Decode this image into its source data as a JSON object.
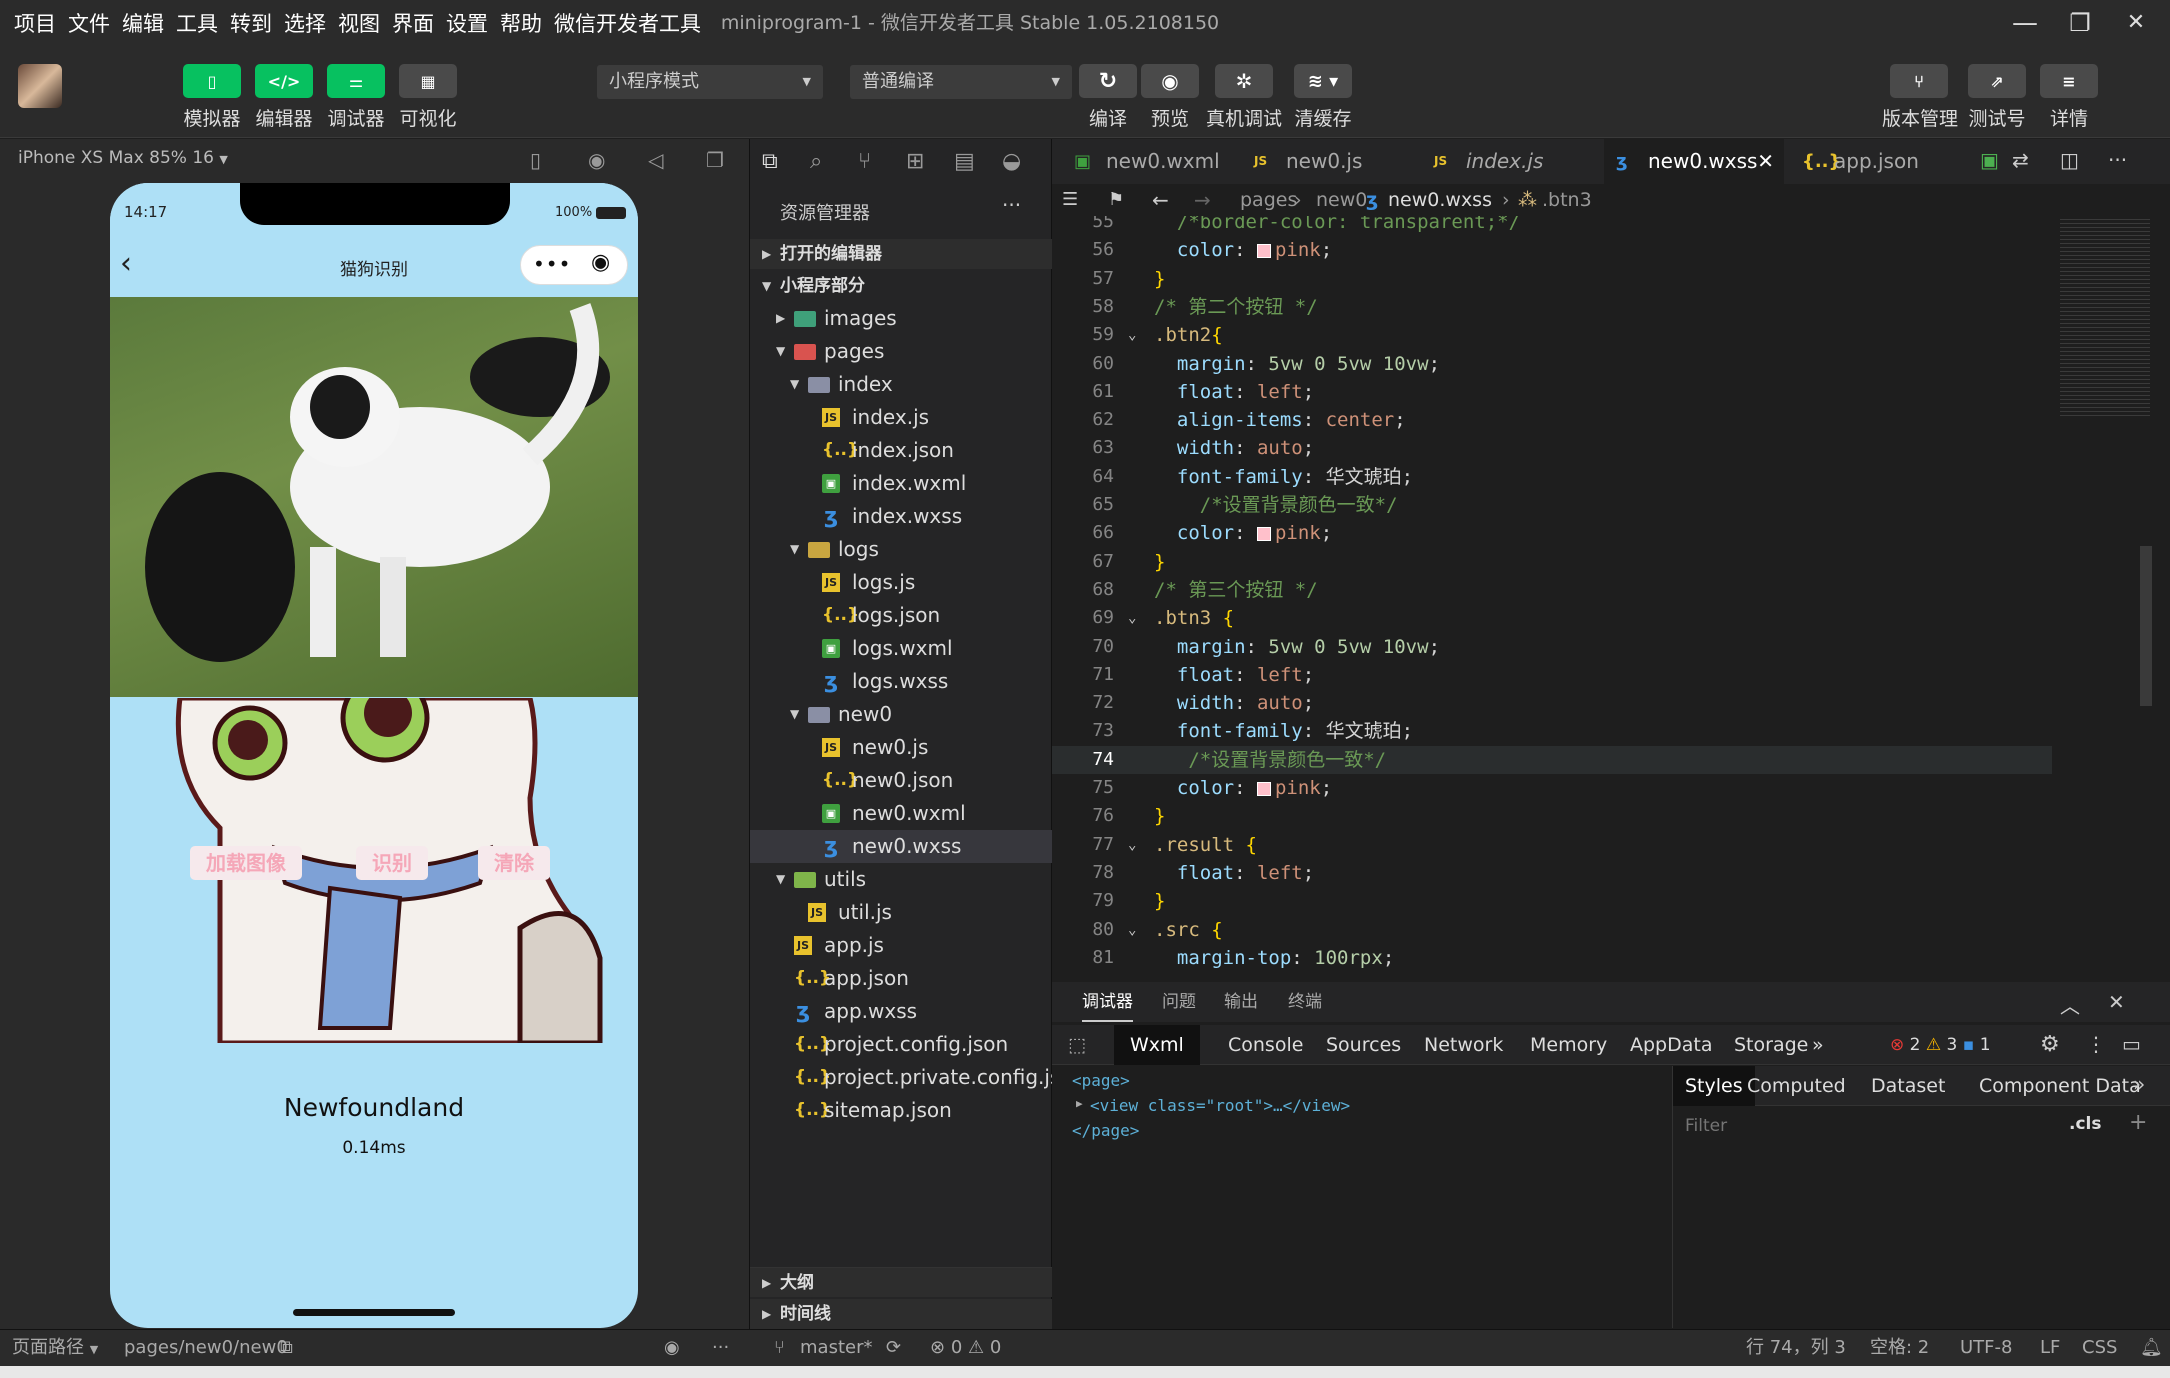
{
  "menu": [
    "项目",
    "文件",
    "编辑",
    "工具",
    "转到",
    "选择",
    "视图",
    "界面",
    "设置",
    "帮助",
    "微信开发者工具"
  ],
  "window_title": "miniprogram-1 - 微信开发者工具 Stable 1.05.2108150",
  "window_controls": {
    "minimize": "—",
    "maximize": "❐",
    "close": "✕"
  },
  "toolbar": {
    "simulator": "模拟器",
    "editor": "编辑器",
    "debugger": "调试器",
    "visual": "可视化",
    "mode": "小程序模式",
    "compile_mode": "普通编译",
    "compile": "编译",
    "preview": "预览",
    "real_debug": "真机调试",
    "clear_cache": "清缓存",
    "version": "版本管理",
    "test_id": "测试号",
    "details": "详情"
  },
  "simulator": {
    "device": "iPhone XS Max 85% 16",
    "time": "14:17",
    "battery": "100%",
    "nav_title": "猫狗识别",
    "buttons": [
      "加载图像",
      "识别",
      "清除"
    ],
    "result": "Newfoundland",
    "elapsed": "0.14ms"
  },
  "explorer": {
    "title": "资源管理器",
    "open_editors": "打开的编辑器",
    "project": "小程序部分",
    "tree": [
      {
        "label": "images",
        "depth": 1,
        "type": "folder-img",
        "twisty": "closed"
      },
      {
        "label": "pages",
        "depth": 1,
        "type": "folder-pg",
        "twisty": "open"
      },
      {
        "label": "index",
        "depth": 2,
        "type": "folder-idx",
        "twisty": "open"
      },
      {
        "label": "index.js",
        "depth": 3,
        "type": "js"
      },
      {
        "label": "index.json",
        "depth": 3,
        "type": "json"
      },
      {
        "label": "index.wxml",
        "depth": 3,
        "type": "wxml"
      },
      {
        "label": "index.wxss",
        "depth": 3,
        "type": "wxss"
      },
      {
        "label": "logs",
        "depth": 2,
        "type": "folder-lg",
        "twisty": "open"
      },
      {
        "label": "logs.js",
        "depth": 3,
        "type": "js"
      },
      {
        "label": "logs.json",
        "depth": 3,
        "type": "json"
      },
      {
        "label": "logs.wxml",
        "depth": 3,
        "type": "wxml"
      },
      {
        "label": "logs.wxss",
        "depth": 3,
        "type": "wxss"
      },
      {
        "label": "new0",
        "depth": 2,
        "type": "folder-idx",
        "twisty": "open"
      },
      {
        "label": "new0.js",
        "depth": 3,
        "type": "js"
      },
      {
        "label": "new0.json",
        "depth": 3,
        "type": "json"
      },
      {
        "label": "new0.wxml",
        "depth": 3,
        "type": "wxml"
      },
      {
        "label": "new0.wxss",
        "depth": 3,
        "type": "wxss",
        "selected": true
      },
      {
        "label": "utils",
        "depth": 1,
        "type": "folder-ut",
        "twisty": "open"
      },
      {
        "label": "util.js",
        "depth": 2,
        "type": "js"
      },
      {
        "label": "app.js",
        "depth": 1,
        "type": "js"
      },
      {
        "label": "app.json",
        "depth": 1,
        "type": "json"
      },
      {
        "label": "app.wxss",
        "depth": 1,
        "type": "wxss"
      },
      {
        "label": "project.config.json",
        "depth": 1,
        "type": "json"
      },
      {
        "label": "project.private.config.js...",
        "depth": 1,
        "type": "json"
      },
      {
        "label": "sitemap.json",
        "depth": 1,
        "type": "json"
      }
    ],
    "outline": "大纲",
    "timeline": "时间线"
  },
  "tabs": [
    {
      "label": "new0.wxml",
      "type": "wxml"
    },
    {
      "label": "new0.js",
      "type": "js"
    },
    {
      "label": "index.js",
      "type": "js"
    },
    {
      "label": "new0.wxss",
      "type": "wxss",
      "active": true
    },
    {
      "label": "app.json",
      "type": "json"
    }
  ],
  "breadcrumb": [
    "pages",
    "new0",
    "new0.wxss",
    ".btn3"
  ],
  "code": [
    {
      "n": "55",
      "t": [
        [
          "c-com",
          "  /*border-color: transparent;*/"
        ]
      ]
    },
    {
      "n": "56",
      "t": [
        [
          "c-prop",
          "  color"
        ],
        [
          "c-pun",
          ": "
        ],
        [
          "sw",
          ""
        ],
        [
          "c-val",
          "pink"
        ],
        [
          "c-pun",
          ";"
        ]
      ]
    },
    {
      "n": "57",
      "t": [
        [
          "c-brace",
          "}"
        ]
      ]
    },
    {
      "n": "58",
      "t": [
        [
          "c-com",
          "/* 第二个按钮 */"
        ]
      ]
    },
    {
      "n": "59",
      "t": [
        [
          "c-sel",
          ".btn2"
        ],
        [
          "c-brace",
          "{"
        ]
      ],
      "fold": true
    },
    {
      "n": "60",
      "t": [
        [
          "c-prop",
          "  margin"
        ],
        [
          "c-pun",
          ": "
        ],
        [
          "c-num",
          "5vw 0 5vw 10vw"
        ],
        [
          "c-pun",
          ";"
        ]
      ]
    },
    {
      "n": "61",
      "t": [
        [
          "c-prop",
          "  float"
        ],
        [
          "c-pun",
          ": "
        ],
        [
          "c-val",
          "left"
        ],
        [
          "c-pun",
          ";"
        ]
      ]
    },
    {
      "n": "62",
      "t": [
        [
          "c-prop",
          "  align-items"
        ],
        [
          "c-pun",
          ": "
        ],
        [
          "c-val",
          "center"
        ],
        [
          "c-pun",
          ";"
        ]
      ]
    },
    {
      "n": "63",
      "t": [
        [
          "c-prop",
          "  width"
        ],
        [
          "c-pun",
          ": "
        ],
        [
          "c-val",
          "auto"
        ],
        [
          "c-pun",
          ";"
        ]
      ]
    },
    {
      "n": "64",
      "t": [
        [
          "c-prop",
          "  font-family"
        ],
        [
          "c-pun",
          ": "
        ],
        [
          "c-pun",
          "华文琥珀"
        ],
        [
          "c-pun",
          ";"
        ]
      ]
    },
    {
      "n": "65",
      "t": [
        [
          "c-com",
          "    /*设置背景颜色一致*/"
        ]
      ]
    },
    {
      "n": "66",
      "t": [
        [
          "c-prop",
          "  color"
        ],
        [
          "c-pun",
          ": "
        ],
        [
          "sw",
          ""
        ],
        [
          "c-val",
          "pink"
        ],
        [
          "c-pun",
          ";"
        ]
      ]
    },
    {
      "n": "67",
      "t": [
        [
          "c-brace",
          "}"
        ]
      ]
    },
    {
      "n": "68",
      "t": [
        [
          "c-com",
          "/* 第三个按钮 */"
        ]
      ]
    },
    {
      "n": "69",
      "t": [
        [
          "c-sel",
          ".btn3 "
        ],
        [
          "c-brace",
          "{"
        ]
      ],
      "fold": true
    },
    {
      "n": "70",
      "t": [
        [
          "c-prop",
          "  margin"
        ],
        [
          "c-pun",
          ": "
        ],
        [
          "c-num",
          "5vw 0 5vw 10vw"
        ],
        [
          "c-pun",
          ";"
        ]
      ]
    },
    {
      "n": "71",
      "t": [
        [
          "c-prop",
          "  float"
        ],
        [
          "c-pun",
          ": "
        ],
        [
          "c-val",
          "left"
        ],
        [
          "c-pun",
          ";"
        ]
      ]
    },
    {
      "n": "72",
      "t": [
        [
          "c-prop",
          "  width"
        ],
        [
          "c-pun",
          ": "
        ],
        [
          "c-val",
          "auto"
        ],
        [
          "c-pun",
          ";"
        ]
      ]
    },
    {
      "n": "73",
      "t": [
        [
          "c-prop",
          "  font-family"
        ],
        [
          "c-pun",
          ": "
        ],
        [
          "c-pun",
          "华文琥珀"
        ],
        [
          "c-pun",
          ";"
        ]
      ]
    },
    {
      "n": "74",
      "t": [
        [
          "c-com",
          "   /*设置背景颜色一致*/"
        ]
      ],
      "cur": true
    },
    {
      "n": "75",
      "t": [
        [
          "c-prop",
          "  color"
        ],
        [
          "c-pun",
          ": "
        ],
        [
          "sw",
          ""
        ],
        [
          "c-val",
          "pink"
        ],
        [
          "c-pun",
          ";"
        ]
      ]
    },
    {
      "n": "76",
      "t": [
        [
          "c-brace",
          "}"
        ]
      ]
    },
    {
      "n": "77",
      "t": [
        [
          "c-sel",
          ".result "
        ],
        [
          "c-brace",
          "{"
        ]
      ],
      "fold": true
    },
    {
      "n": "78",
      "t": [
        [
          "c-prop",
          "  float"
        ],
        [
          "c-pun",
          ": "
        ],
        [
          "c-val",
          "left"
        ],
        [
          "c-pun",
          ";"
        ]
      ]
    },
    {
      "n": "79",
      "t": [
        [
          "c-brace",
          "}"
        ]
      ]
    },
    {
      "n": "80",
      "t": [
        [
          "c-sel",
          ".src "
        ],
        [
          "c-brace",
          "{"
        ]
      ],
      "fold": true
    },
    {
      "n": "81",
      "t": [
        [
          "c-prop",
          "  margin-top"
        ],
        [
          "c-pun",
          ": "
        ],
        [
          "c-num",
          "100rpx"
        ],
        [
          "c-pun",
          ";"
        ]
      ]
    }
  ],
  "debugger": {
    "panel_tabs": [
      "调试器",
      "问题",
      "输出",
      "终端"
    ],
    "tools": [
      "Wxml",
      "Console",
      "Sources",
      "Network",
      "Memory",
      "AppData",
      "Storage"
    ],
    "more": "»",
    "errors": "2",
    "warnings": "3",
    "infos": "1",
    "dom": [
      "<page>",
      "<view class=\"root\">…</view>",
      "</page>"
    ],
    "style_tabs": [
      "Styles",
      "Computed",
      "Dataset",
      "Component Data"
    ],
    "filter_placeholder": "Filter",
    "cls": ".cls",
    "plus": "+"
  },
  "status": {
    "page_path_label": "页面路径",
    "page_path": "pages/new0/new0",
    "branch": "master*",
    "errors": "0",
    "warnings": "0",
    "cursor": "行 74，列 3",
    "spaces": "空格: 2",
    "encoding": "UTF-8",
    "eol": "LF",
    "language": "CSS"
  }
}
